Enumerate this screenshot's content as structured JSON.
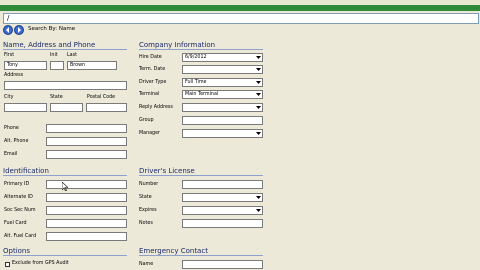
{
  "window": {
    "title": ""
  },
  "toolbar": {
    "input_value": "/"
  },
  "nav": {
    "search_by": "Search By: Name"
  },
  "sections": {
    "name_address": {
      "title": "Name, Address and Phone",
      "first_label": "First",
      "first_value": "Tony",
      "init_label": "Init",
      "init_value": "",
      "last_label": "Last",
      "last_value": "Brown",
      "address_label": "Address",
      "city_label": "City",
      "state_label": "State",
      "postal_label": "Postal Code",
      "phone_label": "Phone",
      "alt_phone_label": "Alt. Phone",
      "email_label": "Email"
    },
    "company": {
      "title": "Company Information",
      "hire_date_label": "Hire Date",
      "hire_date_value": "6/9/2012",
      "term_date_label": "Term. Date",
      "driver_type_label": "Driver Type",
      "driver_type_value": "Full Time",
      "terminal_label": "Terminal",
      "terminal_value": "Main Terminal",
      "reply_label": "Reply Address",
      "group_label": "Group",
      "manager_label": "Manager"
    },
    "identification": {
      "title": "Identification",
      "primary_id_label": "Primary ID",
      "alternate_id_label": "Alternate ID",
      "soc_sec_label": "Soc Sec Num",
      "fuel_card_label": "Fuel Card",
      "alt_fuel_card_label": "Alt. Fuel Card"
    },
    "license": {
      "title": "Driver's License",
      "number_label": "Number",
      "state_label": "State",
      "expires_label": "Expires",
      "notes_label": "Notes"
    },
    "options": {
      "title": "Options",
      "exclude_gps_label": "Exclude from GPS Audit"
    },
    "emergency": {
      "title": "Emergency Contact",
      "name_label": "Name"
    }
  },
  "colors": {
    "accent_green": "#2f8a3a",
    "section_title": "#1a2a6a",
    "background": "#ece9d8"
  }
}
